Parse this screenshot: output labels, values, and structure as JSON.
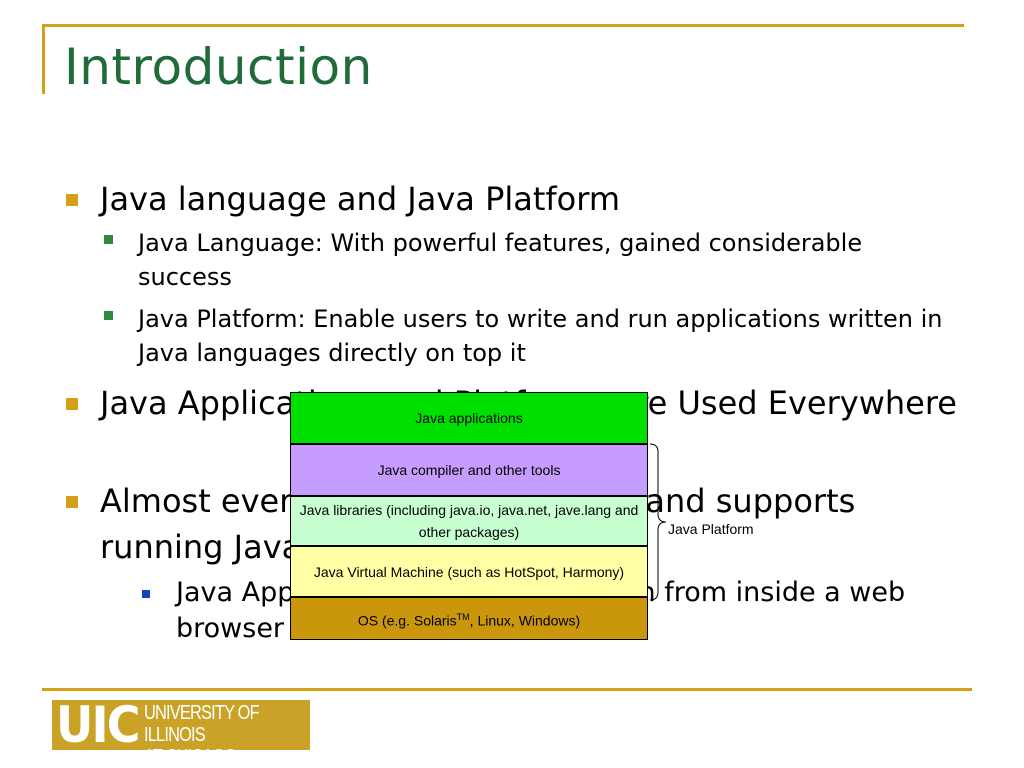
{
  "slide": {
    "title": "Introduction",
    "bullets": [
      {
        "text": "Java language and Java Platform"
      },
      {
        "text": "Java Language: With powerful features, gained considerable success"
      },
      {
        "text": "Java Platform: Enable users to write and run applications written in Java languages directly on top it"
      },
      {
        "text": "Java Applications and Platforms are Used Everywhere"
      },
      {
        "text": "Almost every major OS has a JVM and supports running Java applications"
      },
      {
        "text": "Java Applet is a program that is run from inside a web browser"
      }
    ]
  },
  "diagram": {
    "layers": [
      {
        "label": "Java applications",
        "color": "#00e000"
      },
      {
        "label": "Java compiler and other tools",
        "color": "#c79cff"
      },
      {
        "label": "Java libraries (including java.io, java.net, jave.lang and other packages)",
        "color": "#c8ffd0"
      },
      {
        "label": "Java Virtual Machine (such as HotSpot, Harmony)",
        "color": "#ffffa6"
      },
      {
        "label_prefix": "OS (e.g. Solaris",
        "label_tm": "TM",
        "label_suffix": ", Linux, Windows)",
        "color": "#c9960c"
      }
    ],
    "brace_label": "Java Platform"
  },
  "logo": {
    "abbr": "UIC",
    "line1": "UNIVERSITY OF ILLINOIS",
    "line2": "AT CHICAGO"
  },
  "colors": {
    "title": "#1f6b3a",
    "accent_rule": "#d4a017",
    "level1_bullet": "#d4a017",
    "level2_bullet": "#2e8b3e",
    "level3_bullet": "#1f3fbf"
  }
}
